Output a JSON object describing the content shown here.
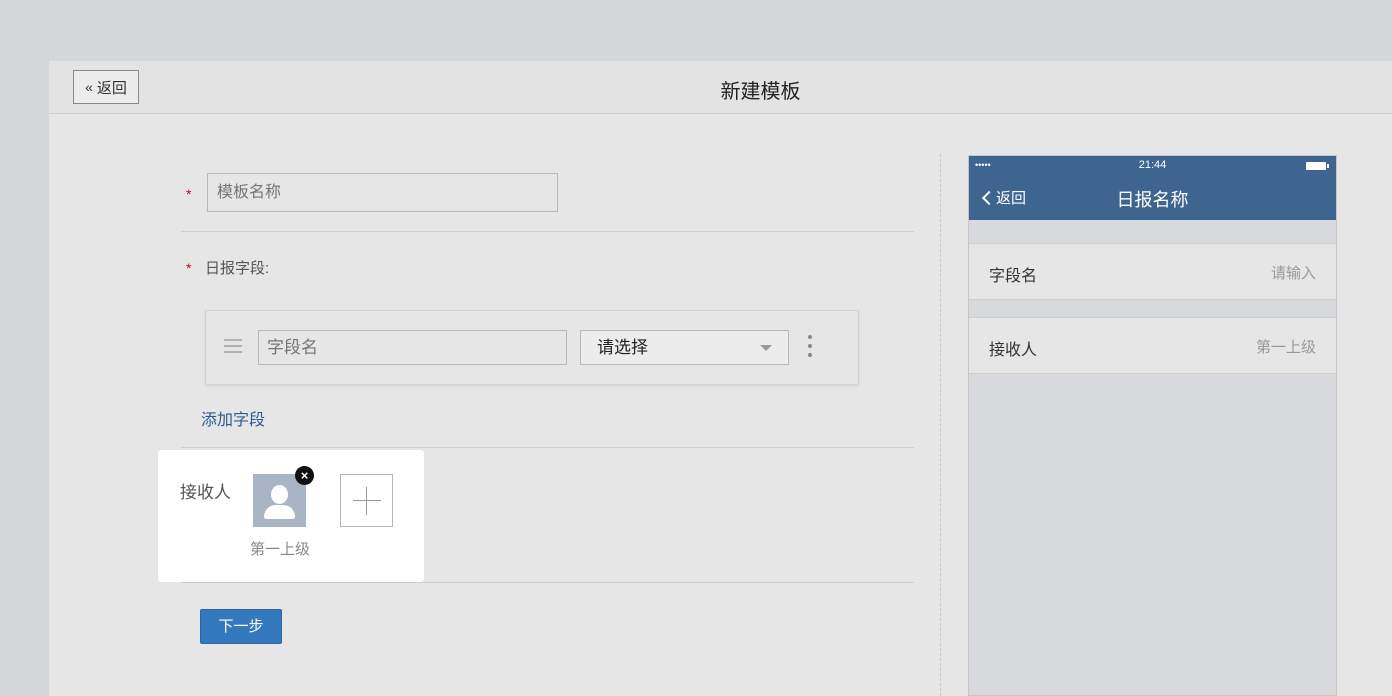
{
  "header": {
    "back_label": "返回",
    "back_icon": "double-chevron-left-icon",
    "title": "新建模板"
  },
  "form": {
    "required_mark": "*",
    "template_name_placeholder": "模板名称",
    "template_name_value": "",
    "fields_label": "日报字段:",
    "field_row": {
      "name_placeholder": "字段名",
      "name_value": "",
      "type_selected": "请选择"
    },
    "add_field_label": "添加字段",
    "receiver": {
      "label": "接收人",
      "items": [
        {
          "name": "第一上级",
          "icon": "user-avatar-icon"
        }
      ]
    },
    "next_label": "下一步"
  },
  "preview": {
    "status": {
      "signal": "•••••",
      "time": "21:44"
    },
    "back_label": "返回",
    "title": "日报名称",
    "rows": [
      {
        "key": "字段名",
        "value": "请输入"
      },
      {
        "key": "接收人",
        "value": "第一上级"
      }
    ]
  },
  "colors": {
    "accent": "#3478be",
    "link": "#2e5b8f",
    "phone_header": "#3d6590",
    "required": "#d0021b"
  }
}
